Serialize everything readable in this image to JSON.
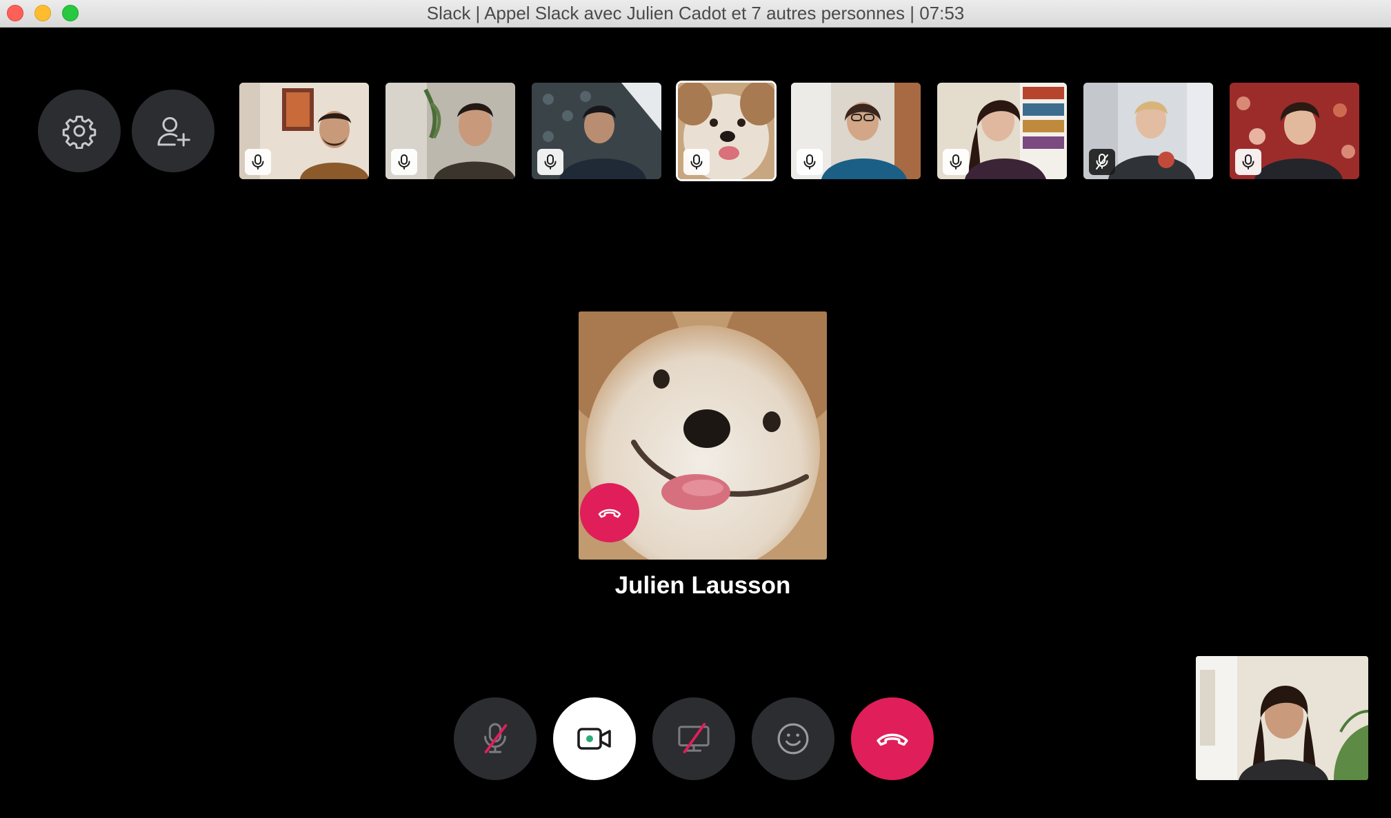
{
  "window": {
    "title": "Slack | Appel Slack avec Julien Cadot et 7 autres personnes | 07:53"
  },
  "top_controls": {
    "settings_icon": "gear-icon",
    "add_person_icon": "add-person-icon"
  },
  "participants": [
    {
      "mic": "on",
      "active": false
    },
    {
      "mic": "on",
      "active": false
    },
    {
      "mic": "on",
      "active": false
    },
    {
      "mic": "on",
      "active": true
    },
    {
      "mic": "on",
      "active": false
    },
    {
      "mic": "on",
      "active": false
    },
    {
      "mic": "muted",
      "active": false
    },
    {
      "mic": "on",
      "active": false
    }
  ],
  "speaker": {
    "name": "Julien Lausson"
  },
  "call_controls": {
    "mic": "mic-muted-icon",
    "video": "video-camera-icon",
    "screen_share": "screen-share-off-icon",
    "reactions": "smiley-icon",
    "hangup": "hangup-icon"
  },
  "colors": {
    "accent_red": "#e01e5a",
    "button_dark": "#2c2d30",
    "video_on_dot": "#2bac76"
  }
}
